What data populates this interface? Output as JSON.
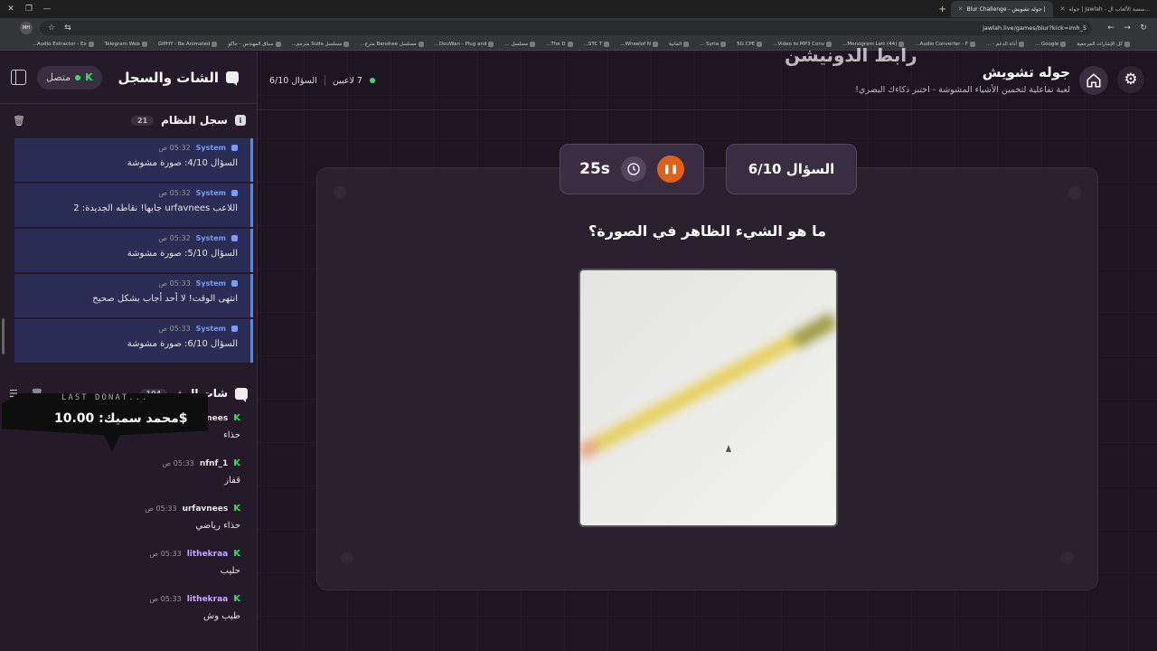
{
  "browser": {
    "tabs": [
      {
        "title": "جولة | Jawlah - منصة الألعاب ال...",
        "active": false
      },
      {
        "title": "Blur Challenge - جوله تشويش |",
        "active": true
      }
    ],
    "url": "jawlah.live/games/blur?kick=imh_5",
    "profile": "MH",
    "bookmarks": [
      "كل الإشارات المرجعية",
      "Google ...",
      "أداة الدعم - ...",
      "Audio Converter - F...",
      "(44) Monogram Lett...",
      "Video to MP3 Conv...",
      "5G CPE",
      "Syria ...",
      "المانية",
      "Wheelof N...",
      "STC T...",
      "The D...",
      "مسلسل ...",
      "DouWan - Plug and...",
      "مسلسل Banshee مترج...",
      "مسلسل Suits مترجم...",
      "سباق المهندس - جاكو",
      "GIPHY - Be Animated",
      "Telegram Web",
      "Audio Extractor - Ex..."
    ]
  },
  "watermark": "رابط الدونيشن",
  "panel": {
    "title": "الشات والسجل",
    "status": "متصل",
    "syslog": {
      "title": "سجل النظام",
      "count": "21",
      "items": [
        {
          "name": "System",
          "time": "05:32 ص",
          "text": "السؤال 4/10: صورة مشوشة"
        },
        {
          "name": "System",
          "time": "05:32 ص",
          "text": "اللاعب urfavnees جابها! نقاطه الجديدة: 2"
        },
        {
          "name": "System",
          "time": "05:32 ص",
          "text": "السؤال 5/10: صورة مشوشة"
        },
        {
          "name": "System",
          "time": "05:33 ص",
          "text": "انتهى الوقت! لا أحد أجاب بشكل صحيح"
        },
        {
          "name": "System",
          "time": "05:33 ص",
          "text": "السؤال 6/10: صورة مشوشة"
        }
      ]
    },
    "stream_chat": {
      "title": "شات البث",
      "count": "104",
      "messages": [
        {
          "user": "urfavnees",
          "time": "05:33 ص",
          "text": "حذاء",
          "color": "#e8e8e8"
        },
        {
          "user": "nfnf_1",
          "time": "05:33 ص",
          "text": "قفاز",
          "color": "#e8e8e8"
        },
        {
          "user": "urfavnees",
          "time": "05:33 ص",
          "text": "حذاء رياضي",
          "color": "#e8e8e8"
        },
        {
          "user": "lithekraa",
          "time": "05:33 ص",
          "text": "حليب",
          "color": "#c9a7ff"
        },
        {
          "user": "lithekraa",
          "time": "05:33 ص",
          "text": "طيب وش",
          "color": "#c9a7ff"
        }
      ]
    }
  },
  "donation": {
    "label": "LAST DONAT...",
    "text": "محمد سميك: 10.00$"
  },
  "game": {
    "title": "جوله تشويش",
    "subtitle": "لعبة تفاعلية لتخمين الأشياء المشوشة - اختبر ذكاءك البصري!",
    "players": "7 لاعبين",
    "question_progress": "السؤال 6/10"
  },
  "card": {
    "question_badge": "السؤال 6/10",
    "timer": "25s",
    "question": "ما هو الشيء الظاهر في الصورة؟"
  },
  "colors": {
    "accent_orange": "#e0621a",
    "online_green": "#3ddc6b",
    "system_blue": "#4a8cf0"
  }
}
